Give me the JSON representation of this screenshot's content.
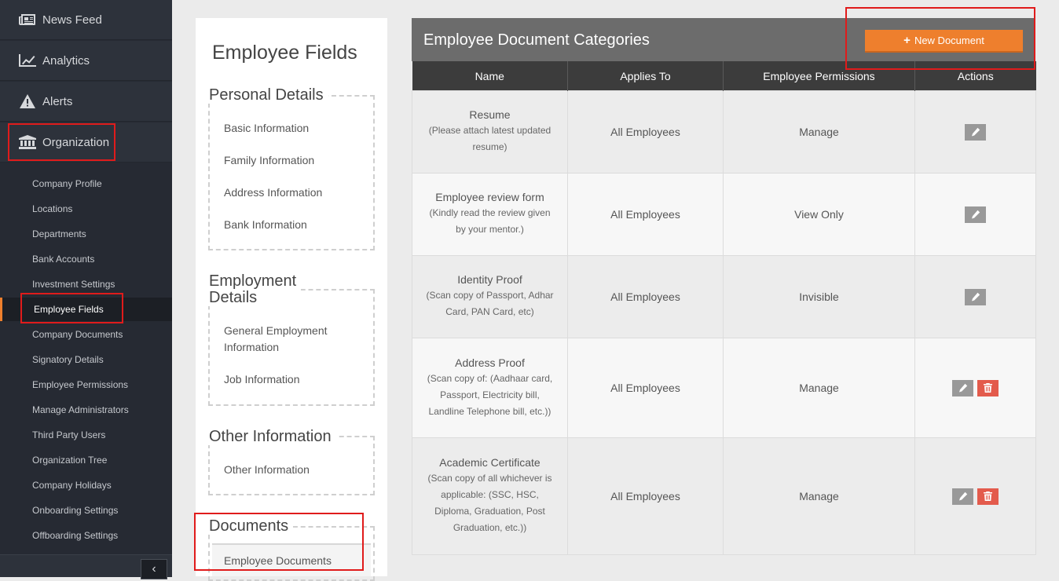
{
  "sidebar": {
    "main_items": [
      {
        "label": "News Feed",
        "icon": "newspaper-icon"
      },
      {
        "label": "Analytics",
        "icon": "line-chart-icon"
      },
      {
        "label": "Alerts",
        "icon": "warning-icon"
      },
      {
        "label": "Organization",
        "icon": "institution-icon"
      }
    ],
    "sub_items": [
      {
        "label": "Company Profile"
      },
      {
        "label": "Locations"
      },
      {
        "label": "Departments"
      },
      {
        "label": "Bank Accounts"
      },
      {
        "label": "Investment Settings"
      },
      {
        "label": "Employee Fields",
        "active": true
      },
      {
        "label": "Company Documents"
      },
      {
        "label": "Signatory Details"
      },
      {
        "label": "Employee Permissions"
      },
      {
        "label": "Manage Administrators"
      },
      {
        "label": "Third Party Users"
      },
      {
        "label": "Organization Tree"
      },
      {
        "label": "Company Holidays"
      },
      {
        "label": "Onboarding Settings"
      },
      {
        "label": "Offboarding Settings"
      }
    ],
    "collapse_symbol": "‹"
  },
  "fields_panel": {
    "title": "Employee Fields",
    "groups": [
      {
        "title": "Personal Details",
        "links": [
          "Basic Information",
          "Family Information",
          "Address Information",
          "Bank Information"
        ]
      },
      {
        "title": "Employment Details",
        "title_lines": [
          "Employment",
          "Details"
        ],
        "links": [
          "General Employment Information",
          "Job Information"
        ]
      },
      {
        "title": "Other Information",
        "links": [
          "Other Information"
        ]
      },
      {
        "title": "Documents",
        "links": [
          "Employee Documents"
        ]
      }
    ]
  },
  "documents": {
    "title": "Employee Document Categories",
    "new_button_label": "New Document",
    "columns": [
      "Name",
      "Applies To",
      "Employee Permissions",
      "Actions"
    ],
    "rows": [
      {
        "name": "Resume",
        "description": "(Please attach latest updated resume)",
        "applies_to": "All Employees",
        "permission": "Manage",
        "can_delete": false
      },
      {
        "name": "Employee review form",
        "description": "(Kindly read the review given by your mentor.)",
        "applies_to": "All Employees",
        "permission": "View Only",
        "can_delete": false
      },
      {
        "name": "Identity Proof",
        "description": "(Scan copy of Passport, Adhar Card, PAN Card, etc)",
        "applies_to": "All Employees",
        "permission": "Invisible",
        "can_delete": false
      },
      {
        "name": "Address Proof",
        "description": "(Scan copy of: (Aadhaar card, Passport, Electricity bill, Landline Telephone bill, etc.))",
        "applies_to": "All Employees",
        "permission": "Manage",
        "can_delete": true
      },
      {
        "name": "Academic Certificate",
        "description": "(Scan copy of all whichever is applicable: (SSC, HSC, Diploma, Graduation, Post Graduation, etc.))",
        "applies_to": "All Employees",
        "permission": "Manage",
        "can_delete": true
      }
    ]
  },
  "colors": {
    "sidebar_bg": "#262a33",
    "accent_orange": "#ee7f2d",
    "table_header": "#3c3c3c",
    "card_header": "#6c6c6c",
    "delete_red": "#e35b4c",
    "highlight_red": "#e01b1b"
  }
}
